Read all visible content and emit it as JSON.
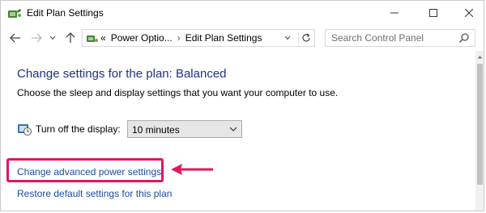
{
  "window": {
    "title": "Edit Plan Settings",
    "icons": {
      "app": "power-options-icon",
      "minimize": "minimize-icon",
      "maximize": "maximize-icon",
      "close": "close-icon"
    }
  },
  "navbar": {
    "icons": {
      "back": "back-arrow-icon",
      "forward": "forward-arrow-icon",
      "recent": "chevron-down-icon",
      "up": "up-arrow-icon",
      "refresh": "refresh-icon",
      "search": "search-icon"
    },
    "address": {
      "prefix": "«",
      "crumbs": [
        "Power Optio...",
        "Edit Plan Settings"
      ],
      "separator": "›"
    },
    "search_placeholder": "Search Control Panel"
  },
  "content": {
    "heading": "Change settings for the plan: Balanced",
    "subtext": "Choose the sleep and display settings that you want your computer to use.",
    "display": {
      "label": "Turn off the display:",
      "value": "10 minutes",
      "icon": "clock-icon"
    },
    "links": {
      "advanced": "Change advanced power settings",
      "restore": "Restore default settings for this plan"
    }
  },
  "colors": {
    "heading": "#1e3287",
    "link": "#1a4ca8",
    "highlight": "#e0175f"
  }
}
